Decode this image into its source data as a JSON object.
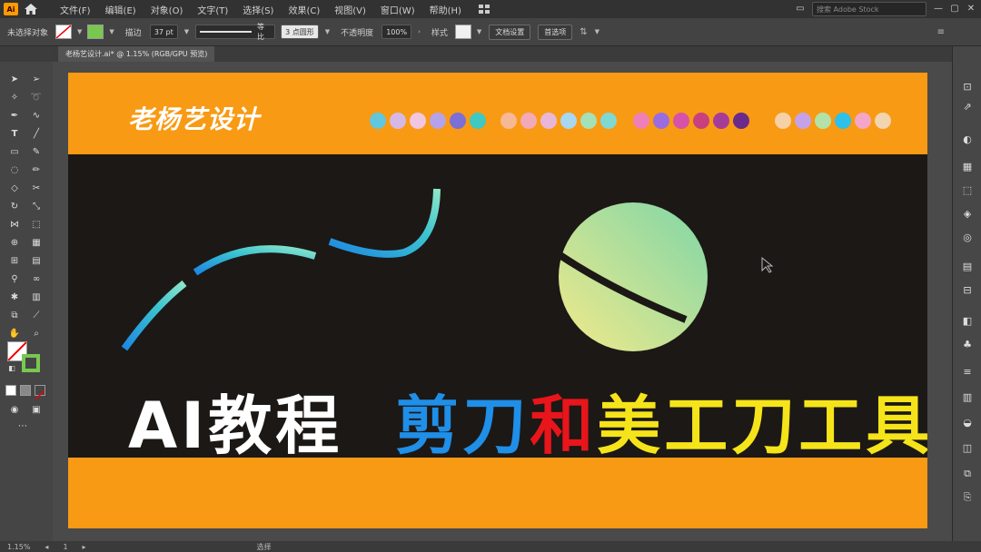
{
  "app": {
    "logo_text": "Ai",
    "menus": [
      "文件(F)",
      "编辑(E)",
      "对象(O)",
      "文字(T)",
      "选择(S)",
      "效果(C)",
      "视图(V)",
      "窗口(W)",
      "帮助(H)"
    ],
    "search_placeholder": "搜索 Adobe Stock",
    "window_controls": [
      "—",
      "▢",
      "✕"
    ]
  },
  "control_bar": {
    "selection_label": "未选择对象",
    "stroke_label": "描边",
    "stroke_weight": "37 pt",
    "stroke_profile": "等比",
    "brush": "3 点圆形",
    "opacity_label": "不透明度",
    "opacity_value": "100%",
    "style_label": "样式",
    "doc_setup_button": "文档设置",
    "preferences_button": "首选项"
  },
  "document": {
    "tab_title": "老杨艺设计.ai* @ 1.15% (RGB/GPU 预览)"
  },
  "artboard": {
    "brand_text": "老杨艺设计",
    "headline": {
      "part1": "AI教程",
      "part2": "剪刀",
      "part3": "和",
      "part4": "美工刀工具"
    },
    "swatch_groups": [
      [
        "#62c6dd",
        "#d6b8e6",
        "#f0c6e0",
        "#b6a2e8",
        "#7c6fd6",
        "#3fc9c0"
      ],
      [
        "#f6b895",
        "#f2a9b8",
        "#e8b7d8",
        "#a8d8f0",
        "#a6e0b6",
        "#7fd9d2"
      ],
      [
        "#ee7fb8",
        "#9b6ce0",
        "#d651a8",
        "#c8407e",
        "#a63c9a",
        "#6a2a8c"
      ],
      [
        "#f6d0a6",
        "#c5a2e8",
        "#b3e2a8",
        "#2ec0e8",
        "#f4a6c8",
        "#f1d4b0"
      ]
    ]
  },
  "status_bar": {
    "zoom": "1.15%",
    "page": "1",
    "mode": "选择"
  },
  "colors": {
    "orange_band": "#f89a14",
    "dark_bg": "#1c1816",
    "headline_blue": "#1f8fe8",
    "headline_red": "#e8151b",
    "headline_yellow": "#f6e41a",
    "stroke_swatch": "#78c850"
  }
}
